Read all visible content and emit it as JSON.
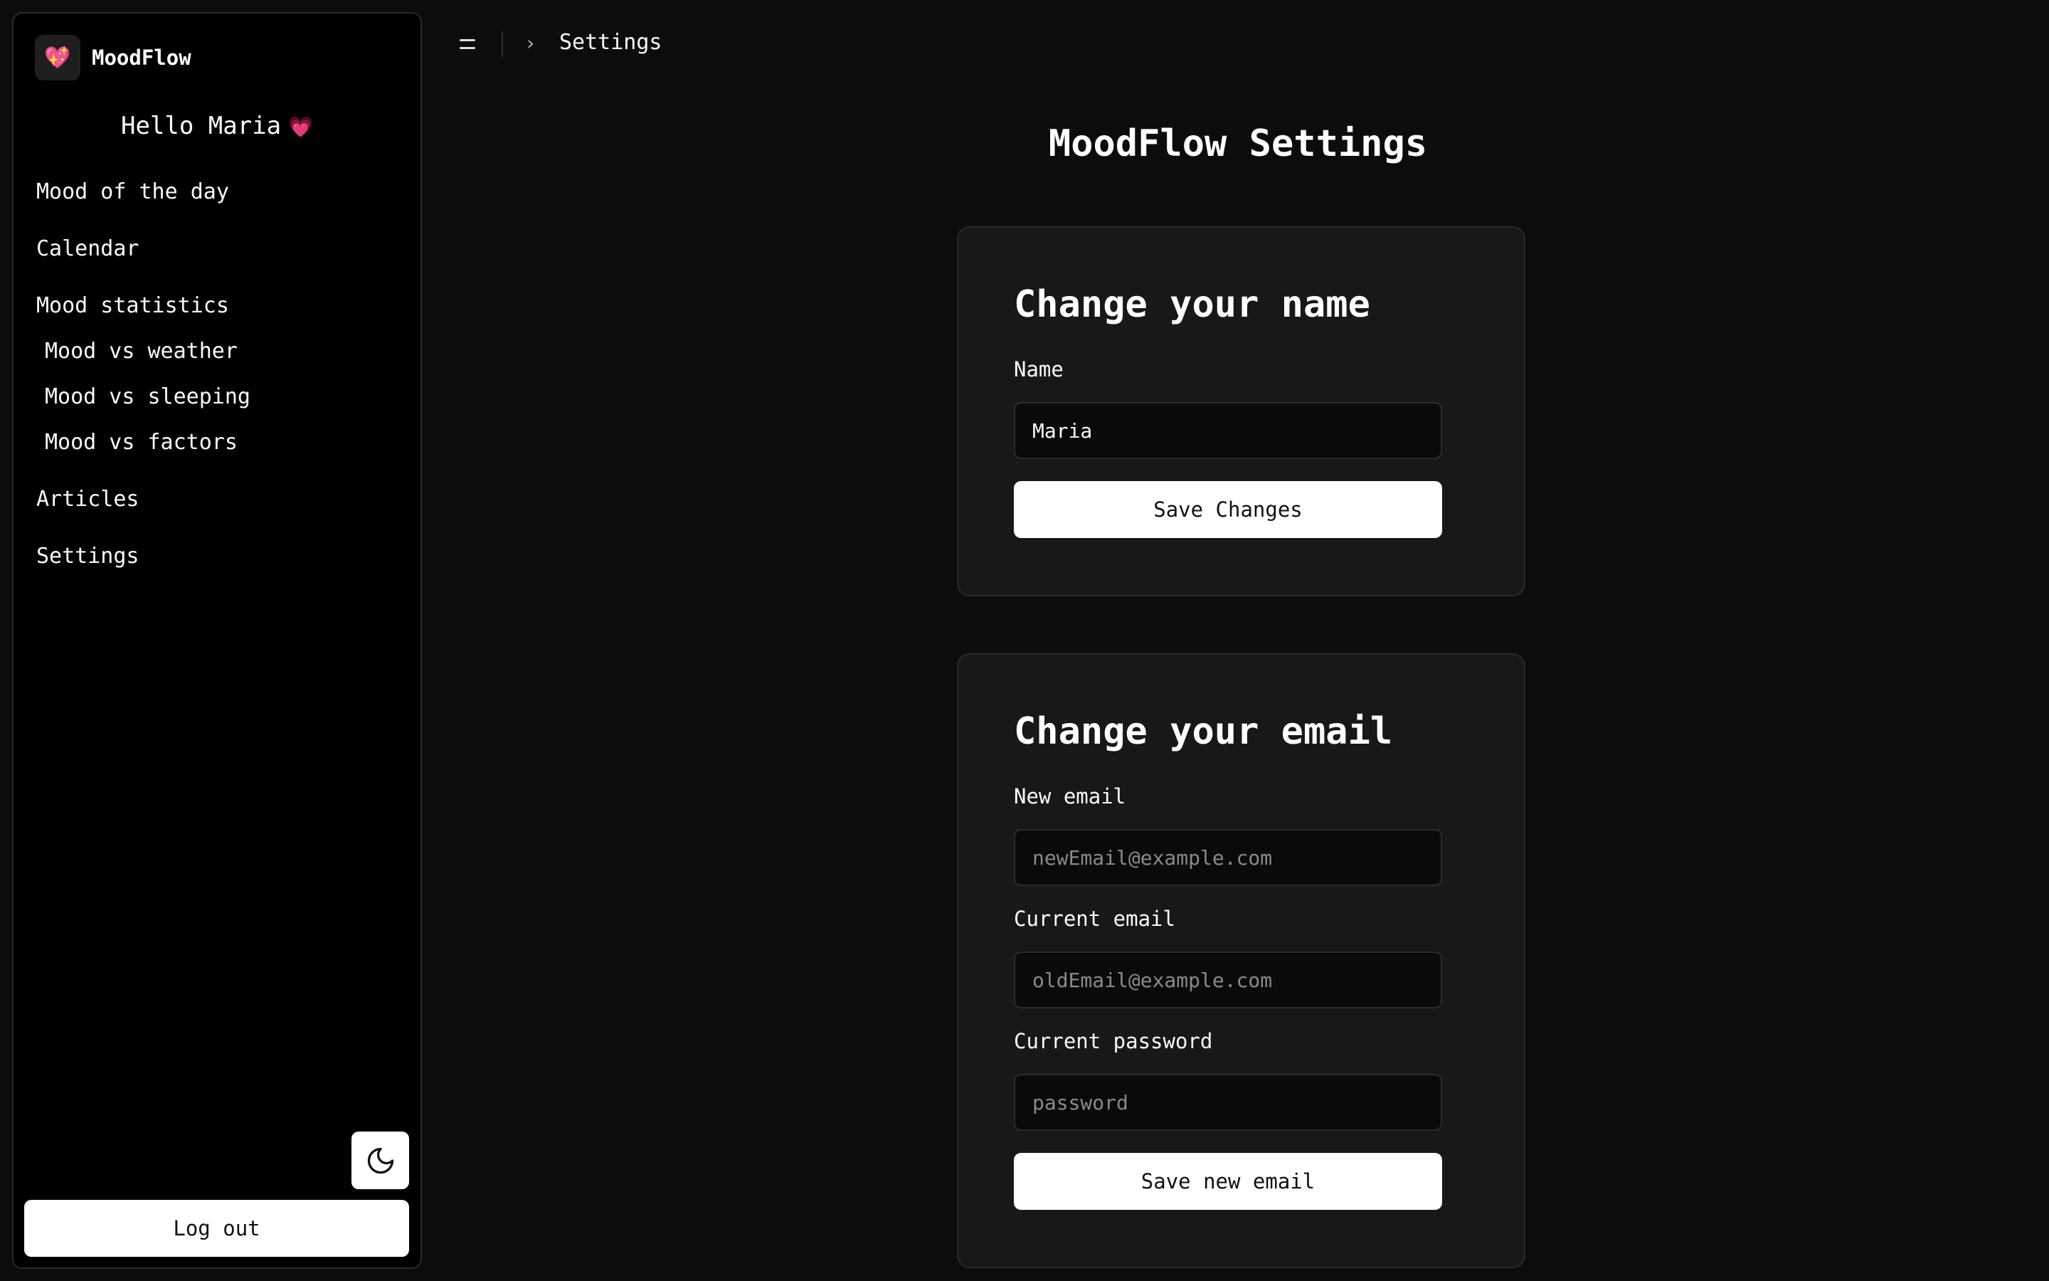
{
  "app": {
    "name": "MoodFlow",
    "logo_icon": "sparkling-heart-icon"
  },
  "sidebar": {
    "greeting": "Hello Maria",
    "greeting_emoji": "💗",
    "items": [
      {
        "label": "Mood of the day"
      },
      {
        "label": "Calendar"
      },
      {
        "label": "Mood statistics"
      },
      {
        "label": "Mood vs weather"
      },
      {
        "label": "Mood vs sleeping"
      },
      {
        "label": "Mood vs factors"
      },
      {
        "label": "Articles"
      },
      {
        "label": "Settings"
      }
    ],
    "theme_toggle_icon": "moon-icon",
    "logout_label": "Log out"
  },
  "topbar": {
    "breadcrumb_current": "Settings"
  },
  "main": {
    "title": "MoodFlow Settings",
    "name_card": {
      "heading": "Change your name",
      "name_label": "Name",
      "name_value": "Maria",
      "save_label": "Save Changes"
    },
    "email_card": {
      "heading": "Change your email",
      "new_email_label": "New email",
      "new_email_placeholder": "newEmail@example.com",
      "current_email_label": "Current email",
      "current_email_placeholder": "oldEmail@example.com",
      "password_label": "Current password",
      "password_placeholder": "password",
      "save_label": "Save new email"
    }
  },
  "colors": {
    "background": "#0c0c0c",
    "sidebar": "#000000",
    "card": "#181818",
    "accent_heart": "#ff5fa2",
    "button": "#ffffff"
  }
}
